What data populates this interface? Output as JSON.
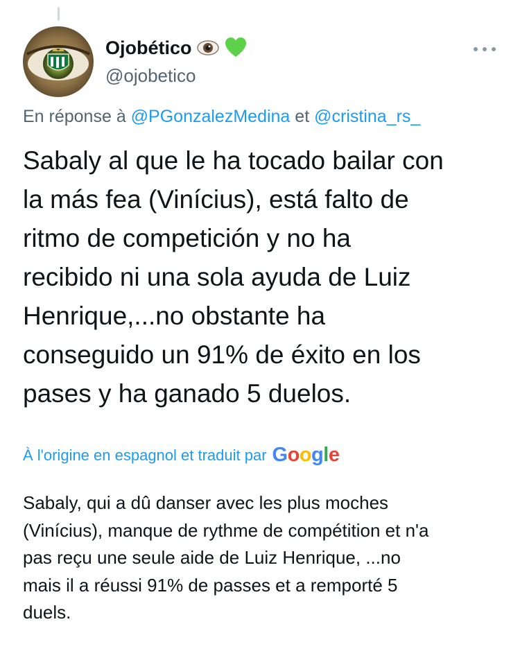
{
  "author": {
    "display_name": "Ojobético",
    "handle": "@ojobetico",
    "avatar_icon": "eye-with-betis-crest-avatar",
    "name_emojis": [
      "eye-emoji-icon",
      "green-heart-emoji-icon"
    ]
  },
  "reply": {
    "prefix": "En réponse à",
    "user1": "@PGonzalezMedina",
    "conjunction": "et",
    "user2": "@cristina_rs_"
  },
  "tweet": {
    "text": "Sabaly al que le ha tocado bailar con\nla más fea (Vinícius), está falto de\nritmo de competición y no ha\nrecibido ni una sola ayuda de Luiz\nHenrique,...no obstante ha\nconseguido un 91% de éxito en los\npases y ha ganado 5 duelos."
  },
  "translation": {
    "label": "À l'origine en espagnol et traduit par",
    "provider_letters": [
      "G",
      "o",
      "o",
      "g",
      "l",
      "e"
    ],
    "provider_colors": [
      "#4285f4",
      "#ea4335",
      "#fbbc05",
      "#4285f4",
      "#34a853",
      "#ea4335"
    ],
    "text": "Sabaly, qui a dû danser avec les plus moches\n(Vinícius), manque de rythme de compétition et n'a\npas reçu une seule aide de Luiz Henrique, ...no\nmais il a réussi 91% de passes et a remporté 5\nduels."
  },
  "colors": {
    "accent": "#1d9bf0",
    "secondary_text": "#536471",
    "primary_text": "#0f1419"
  }
}
